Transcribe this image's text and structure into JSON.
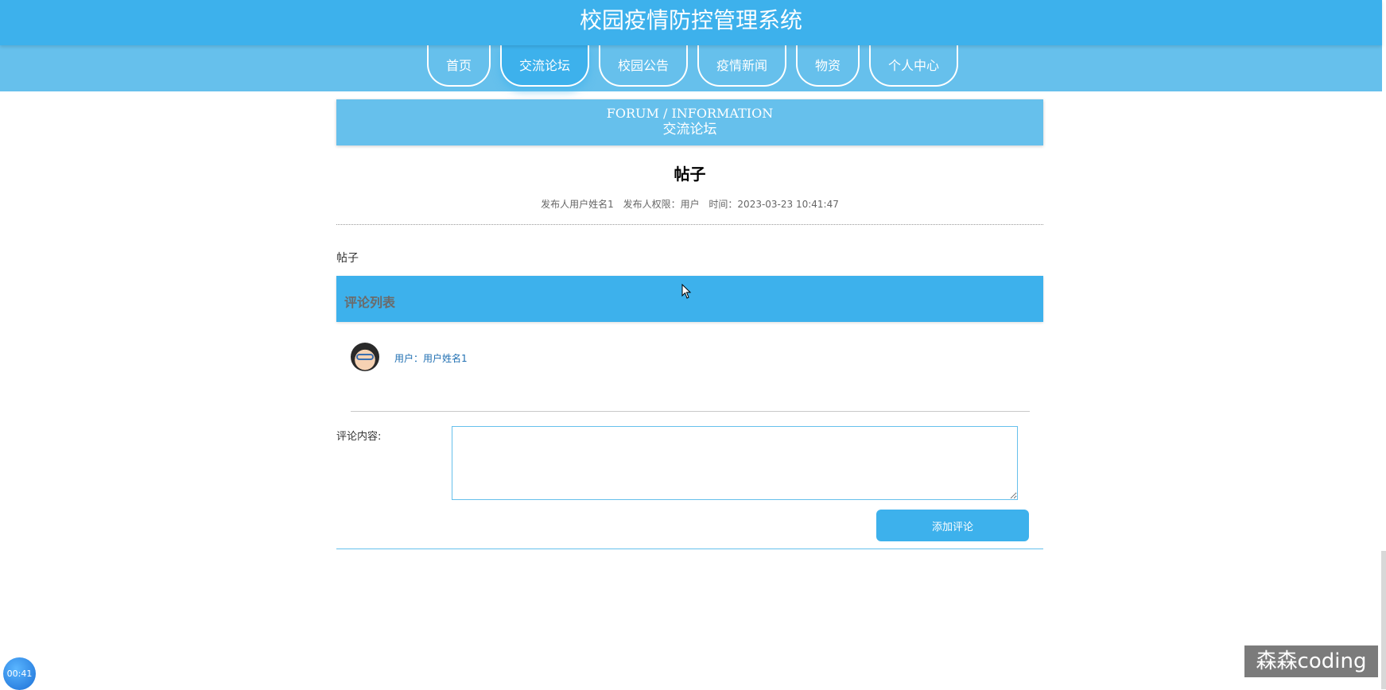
{
  "app": {
    "title": "校园疫情防控管理系统"
  },
  "nav": {
    "items": [
      {
        "label": "首页",
        "active": false
      },
      {
        "label": "交流论坛",
        "active": true
      },
      {
        "label": "校园公告",
        "active": false
      },
      {
        "label": "疫情新闻",
        "active": false
      },
      {
        "label": "物资",
        "active": false
      },
      {
        "label": "个人中心",
        "active": false
      }
    ]
  },
  "section": {
    "english": "FORUM / INFORMATION",
    "chinese": "交流论坛"
  },
  "post": {
    "title": "帖子",
    "author": "发布人用户姓名1",
    "role": "发布人权限：用户",
    "time": "时间：2023-03-23 10:41:47",
    "content": "帖子"
  },
  "comments": {
    "header": "评论列表",
    "items": [
      {
        "user": "用户：用户姓名1"
      }
    ]
  },
  "form": {
    "label": "评论内容:",
    "value": "",
    "placeholder": "",
    "submit_label": "添加评论"
  },
  "overlay": {
    "timer": "00:41",
    "watermark": "森森coding"
  },
  "colors": {
    "primary": "#3db1ec",
    "secondary": "#66c0ec"
  }
}
